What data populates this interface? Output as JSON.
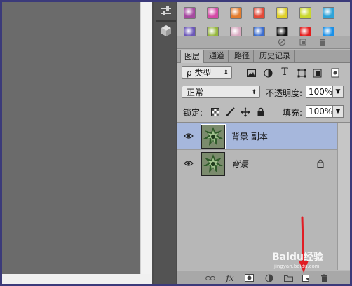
{
  "swatches": {
    "row1_colors": [
      "#a64aa0",
      "#d44aa7",
      "#e47c2c",
      "#e34a38",
      "#e0d02a",
      "#c9d72e",
      "#2ea3d8"
    ],
    "row2_colors": [
      "#6b57b8",
      "#95b63c",
      "#d8a9c0",
      "#3a6ccf",
      "#111111",
      "#e41b1b",
      "#1a90e8"
    ]
  },
  "tabs": [
    {
      "label": "图层",
      "active": true
    },
    {
      "label": "通道",
      "active": false
    },
    {
      "label": "路径",
      "active": false
    },
    {
      "label": "历史记录",
      "active": false
    }
  ],
  "filter": {
    "kind_label": "ρ 类型"
  },
  "blend": {
    "mode": "正常",
    "opacity_label": "不透明度:",
    "opacity_value": "100%"
  },
  "lock": {
    "label": "锁定:",
    "fill_label": "填充:",
    "fill_value": "100%"
  },
  "layers": [
    {
      "name": "背景 副本",
      "selected": true,
      "italic": false,
      "locked": false
    },
    {
      "name": "背景",
      "selected": false,
      "italic": true,
      "locked": true
    }
  ],
  "watermark": {
    "brand": "Baidu经验",
    "sub": "jingyan.baidu.com"
  },
  "colors": {
    "selection": "#a6b7dc",
    "arrow": "#e11d24",
    "panel": "#b9b9b9"
  }
}
